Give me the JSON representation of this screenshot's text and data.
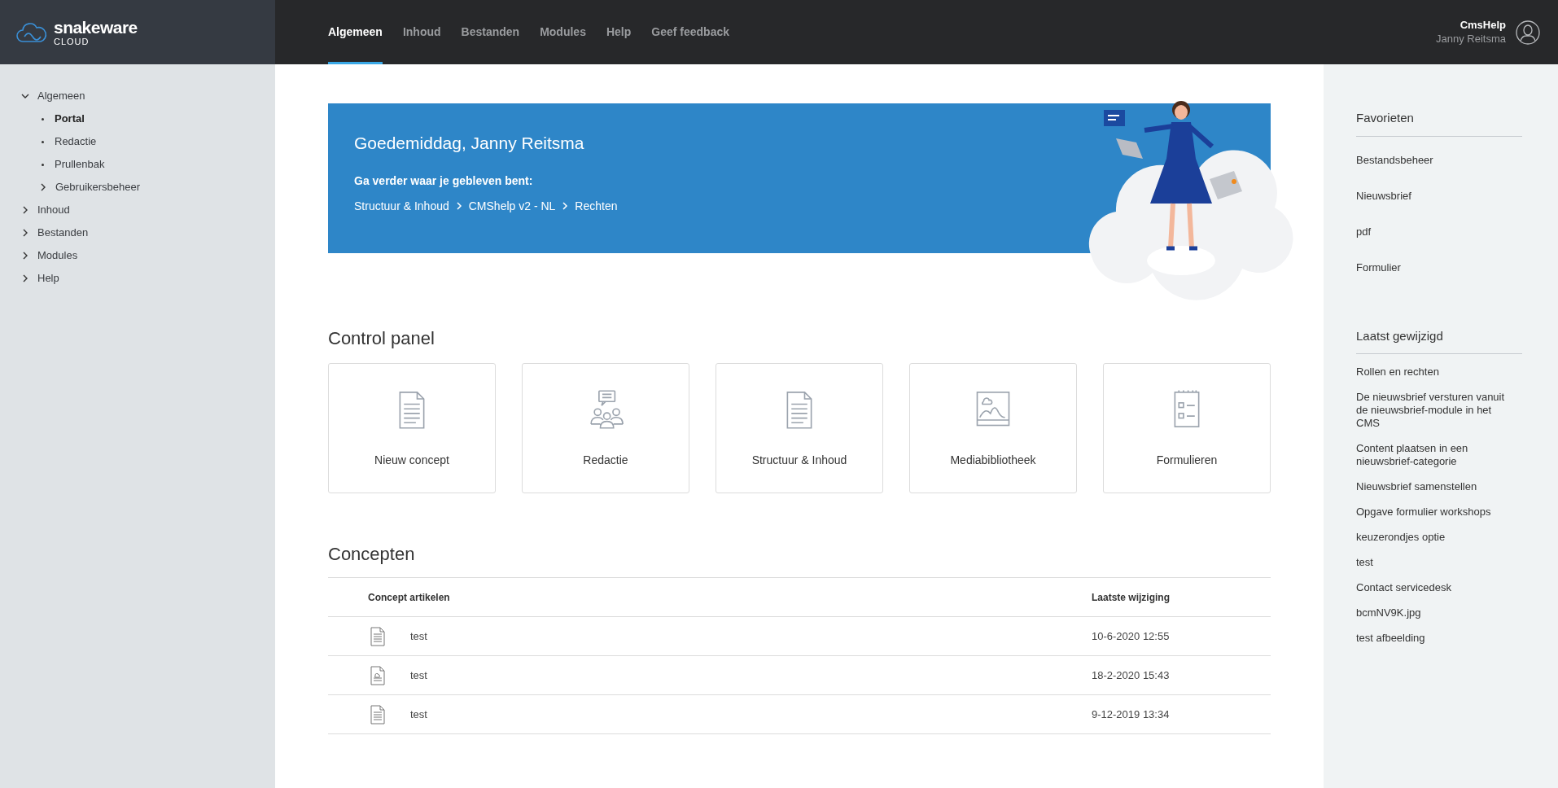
{
  "brand": {
    "name": "snakeware",
    "sub": "CLOUD"
  },
  "nav_tabs": [
    {
      "label": "Algemeen",
      "selected": true
    },
    {
      "label": "Inhoud",
      "selected": false
    },
    {
      "label": "Bestanden",
      "selected": false
    },
    {
      "label": "Modules",
      "selected": false
    },
    {
      "label": "Help",
      "selected": false
    },
    {
      "label": "Geef feedback",
      "selected": false
    }
  ],
  "user": {
    "site": "CmsHelp",
    "name": "Janny Reitsma"
  },
  "sidebar": {
    "items": [
      {
        "label": "Algemeen",
        "expanded": true,
        "selected": false,
        "children": [
          {
            "label": "Portal",
            "selected": true
          },
          {
            "label": "Redactie",
            "selected": false
          },
          {
            "label": "Prullenbak",
            "selected": false
          },
          {
            "label": "Gebruikersbeheer",
            "expanded": false,
            "selected": false
          }
        ]
      },
      {
        "label": "Inhoud",
        "expanded": false,
        "selected": false
      },
      {
        "label": "Bestanden",
        "expanded": false,
        "selected": false
      },
      {
        "label": "Modules",
        "expanded": false,
        "selected": false
      },
      {
        "label": "Help",
        "expanded": false,
        "selected": false
      }
    ]
  },
  "banner": {
    "greeting": "Goedemiddag, Janny Reitsma",
    "continue_label": "Ga verder waar je gebleven bent:",
    "breadcrumb": [
      "Structuur & Inhoud",
      "CMShelp v2 - NL",
      "Rechten"
    ]
  },
  "control_panel": {
    "title": "Control panel",
    "tiles": [
      {
        "label": "Nieuw concept",
        "kind": "document"
      },
      {
        "label": "Redactie",
        "kind": "team"
      },
      {
        "label": "Structuur & Inhoud",
        "kind": "document"
      },
      {
        "label": "Mediabibliotheek",
        "kind": "image"
      },
      {
        "label": "Formulieren",
        "kind": "form"
      }
    ]
  },
  "concepts": {
    "title": "Concepten",
    "columns": [
      "Concept artikelen",
      "Laatste wijziging"
    ],
    "rows": [
      {
        "kind": "text",
        "title": "test",
        "modified": "10-6-2020 12:55"
      },
      {
        "kind": "image",
        "title": "test",
        "modified": "18-2-2020 15:43"
      },
      {
        "kind": "text",
        "title": "test",
        "modified": "9-12-2019 13:34"
      }
    ]
  },
  "favorites": {
    "title": "Favorieten",
    "items": [
      "Bestandsbeheer",
      "Nieuwsbrief",
      "pdf",
      "Formulier"
    ]
  },
  "recent": {
    "title": "Laatst gewijzigd",
    "items": [
      "Rollen en rechten",
      "De nieuwsbrief versturen vanuit de nieuwsbrief-module in het CMS",
      "Content plaatsen in een nieuwsbrief-categorie",
      "Nieuwsbrief samenstellen",
      "Opgave formulier workshops",
      "keuzerondjes optie",
      "test",
      "Contact servicedesk",
      "bcmNV9K.jpg",
      "test afbeelding"
    ]
  }
}
